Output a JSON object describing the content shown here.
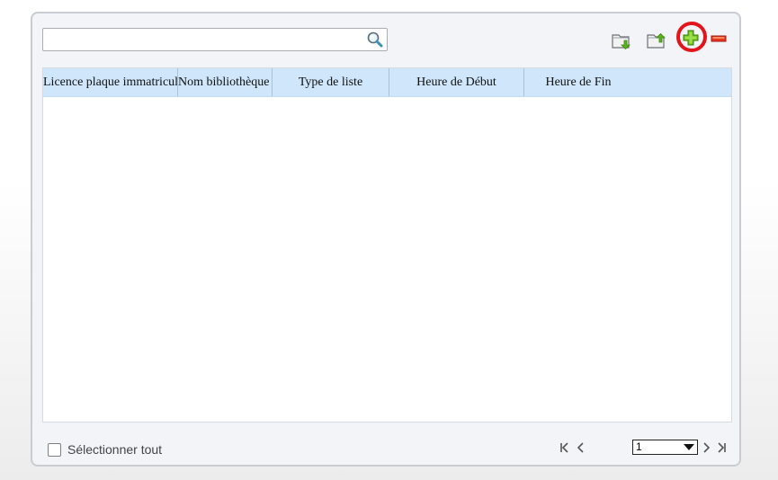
{
  "search": {
    "value": "",
    "placeholder": ""
  },
  "toolbar": {
    "import_icon": "folder-import-icon",
    "export_icon": "folder-export-icon",
    "add_icon": "plus-icon",
    "remove_icon": "minus-icon",
    "highlight_color": "#e3141b"
  },
  "table": {
    "columns": [
      "Licence plaque immatriculation",
      "Nom bibliothèque",
      "Type de liste",
      "Heure de Début",
      "Heure de Fin"
    ],
    "rows": []
  },
  "footer": {
    "select_all_label": "Sélectionner tout",
    "page_value": "1"
  },
  "colors": {
    "header_bg": "#cfe6fb",
    "panel_bg": "#f3f4f7",
    "add_green": "#5bb31b",
    "remove_red": "#e3141b"
  }
}
